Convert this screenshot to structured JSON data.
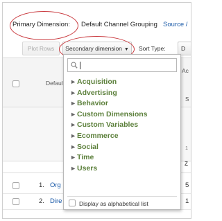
{
  "report": {
    "primary_dimension_label": "Primary Dimension:",
    "primary_dimension_value": "Default Channel Grouping",
    "source_link": "Source /"
  },
  "toolbar": {
    "plot_rows_label": "Plot Rows",
    "secondary_dimension_label": "Secondary dimension",
    "sort_type_label": "Sort Type:",
    "sort_type_value": "D"
  },
  "table": {
    "header_dimension": "Default",
    "right_header_top": "Ac",
    "right_header_sub": "S",
    "summary_small": "1",
    "summary_bold": "Z",
    "rows": [
      {
        "num": "1.",
        "name": "Org",
        "value": "5"
      },
      {
        "num": "2.",
        "name": "Dire",
        "value": "1"
      }
    ]
  },
  "dropdown": {
    "search_placeholder": "",
    "categories": [
      "Acquisition",
      "Advertising",
      "Behavior",
      "Custom Dimensions",
      "Custom Variables",
      "Ecommerce",
      "Social",
      "Time",
      "Users"
    ],
    "alphabetical_label": "Display as alphabetical list"
  },
  "colors": {
    "annotation_circle": "#c9383d",
    "category_green": "#5b7f3a",
    "link_blue": "#1a5aa8"
  }
}
